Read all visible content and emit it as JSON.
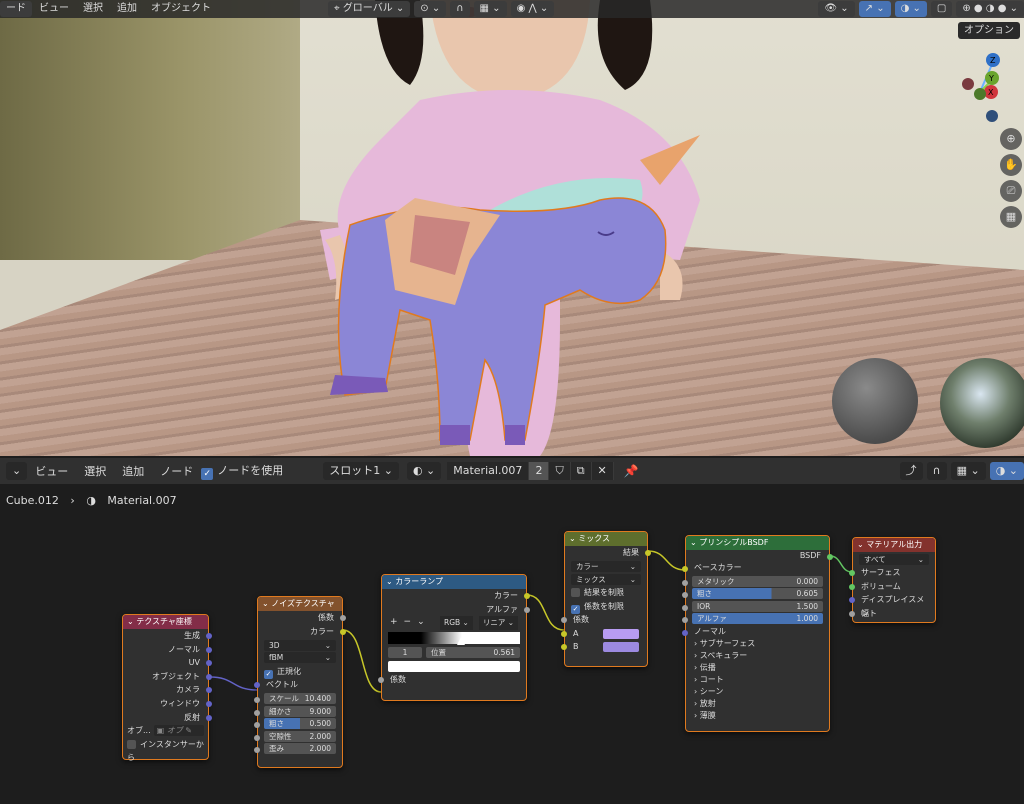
{
  "viewport": {
    "menu": [
      "ード",
      "ビュー",
      "選択",
      "追加",
      "オブジェクト"
    ],
    "transform_orientation": "グローバル",
    "options_button": "オプション",
    "gizmo": {
      "x": "X",
      "y": "Y",
      "z": "Z"
    }
  },
  "node_editor": {
    "menu": [
      "ビュー",
      "選択",
      "追加",
      "ノード"
    ],
    "use_nodes": "ノードを使用",
    "slot": "スロット1",
    "material_name": "Material.007",
    "user_count": "2",
    "breadcrumb": [
      "Cube.012",
      "Material.007"
    ]
  },
  "nodes": {
    "texcoord": {
      "title": "テクスチャ座標",
      "outputs": [
        "生成",
        "ノーマル",
        "UV",
        "オブジェクト",
        "カメラ",
        "ウィンドウ",
        "反射"
      ],
      "object_label": "オブ...",
      "object_placeholder": "オブ",
      "instancer": "インスタンサーから"
    },
    "noise": {
      "title": "ノイズテクスチャ",
      "outputs": [
        "係数",
        "カラー"
      ],
      "dimension": "3D",
      "type": "fBM",
      "normalize": "正規化",
      "vector": "ベクトル",
      "params": [
        {
          "label": "スケール",
          "value": "10.400"
        },
        {
          "label": "細かさ",
          "value": "9.000"
        },
        {
          "label": "粗さ",
          "value": "0.500"
        },
        {
          "label": "空隙性",
          "value": "2.000"
        },
        {
          "label": "歪み",
          "value": "2.000"
        }
      ]
    },
    "colorramp": {
      "title": "カラーランプ",
      "outputs": [
        "カラー",
        "アルファ"
      ],
      "mode": "RGB",
      "interp": "リニア",
      "stop_index": "1",
      "pos_label": "位置",
      "pos_value": "0.561",
      "input": "係数",
      "plus": "+",
      "minus": "−"
    },
    "mix": {
      "title": "ミックス",
      "output": "結果",
      "data_type": "カラー",
      "blend": "ミックス",
      "clamp_result": "結果を制限",
      "clamp_factor": "係数を制限",
      "factor": "係数",
      "a": "A",
      "b": "B",
      "color_a": "#b89cf2",
      "color_b": "#9c8ae0"
    },
    "bsdf": {
      "title": "プリンシプルBSDF",
      "output": "BSDF",
      "base_color": "ベースカラー",
      "params": [
        {
          "label": "メタリック",
          "value": "0.000",
          "fill": 0
        },
        {
          "label": "粗さ",
          "value": "0.605",
          "fill": 0.605
        },
        {
          "label": "IOR",
          "value": "1.500",
          "fill": 0
        },
        {
          "label": "アルファ",
          "value": "1.000",
          "fill": 1
        }
      ],
      "normal": "ノーマル",
      "panels": [
        "サブサーフェス",
        "スペキュラー",
        "伝播",
        "コート",
        "シーン",
        "放射",
        "薄膜"
      ]
    },
    "output": {
      "title": "マテリアル出力",
      "target": "すべて",
      "inputs": [
        "サーフェス",
        "ボリューム",
        "ディスプレイスメント",
        "幅"
      ]
    }
  },
  "colors": {
    "texcoord_header": "#832d48",
    "noise_header": "#83522d",
    "ramp_header": "#2d5a83",
    "mix_header": "#5e6e2d",
    "bsdf_header": "#2d6e3a",
    "output_header": "#83322d",
    "selection": "#e07a1f"
  }
}
